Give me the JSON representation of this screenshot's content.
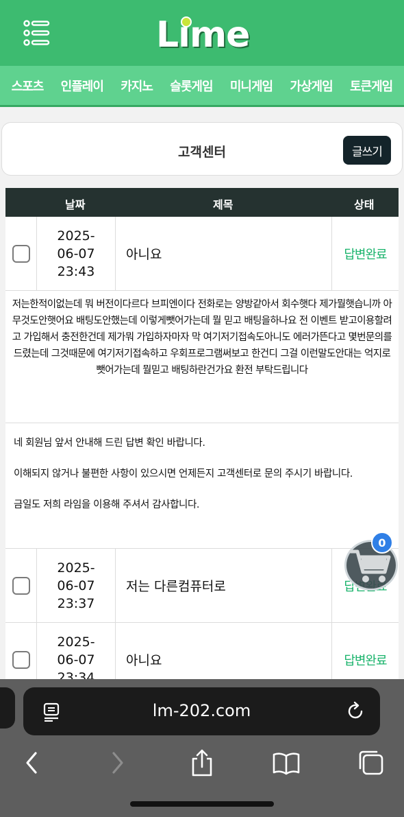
{
  "site": {
    "logo": "Lime"
  },
  "nav": [
    "스포츠",
    "인플레이",
    "카지노",
    "슬롯게임",
    "미니게임",
    "가상게임",
    "토큰게임"
  ],
  "cs": {
    "title": "고객센터",
    "write_label": "글쓰기"
  },
  "table": {
    "headers": {
      "date": "날짜",
      "title": "제목",
      "status": "상태"
    },
    "rows": [
      {
        "date_line1": "2025-",
        "date_line2": "06-07",
        "date_line3": "23:43",
        "title": "아니요",
        "status": "답변완료"
      },
      {
        "date_line1": "2025-",
        "date_line2": "06-07",
        "date_line3": "23:37",
        "title": "저는 다른컴퓨터로",
        "status": "답변완료"
      },
      {
        "date_line1": "2025-",
        "date_line2": "06-07",
        "date_line3": "23:34",
        "title": "아니요",
        "status": "답변완료"
      }
    ],
    "question": "저는한적이없는데 뭐 버전이다르다 브피엔이다 전화로는 양방같아서 회수햇다 제가뭘햇습니까 아무것도안햇어요 배팅도안했는데 이렇게뺏어가는데 뭘 믿고 배팅을하나요 전 이벤트 받고이용할려고 가입해서 충전한건데 제가뭐 가입하자마자 막 여기저기접속도아니도 에러가뜬다고 몇번문의를드렸는데 그것때문에 여기저기접속하고 우회프로그램써보고 한건디 그걸 이런말도안대는 억지로 뺏어가는데 뭘믿고 배팅하란건가요 환전 부탁드립니다",
    "answer": {
      "line1": "네 회원님 앞서 안내해 드린 답변 확인 바랍니다.",
      "line2": "이해되지 않거나 불편한 사항이 있으시면 언제든지 고객센터로 문의 주시기 바랍니다.",
      "line3": "금일도 저희 라임을 이용해 주셔서 감사합니다."
    }
  },
  "cart": {
    "count": "0"
  },
  "browser": {
    "url": "lm-202.com"
  },
  "colors": {
    "header": "#3dbb70",
    "nav": "#5fd28f",
    "status": "#19b36b",
    "table_head": "#253230"
  }
}
